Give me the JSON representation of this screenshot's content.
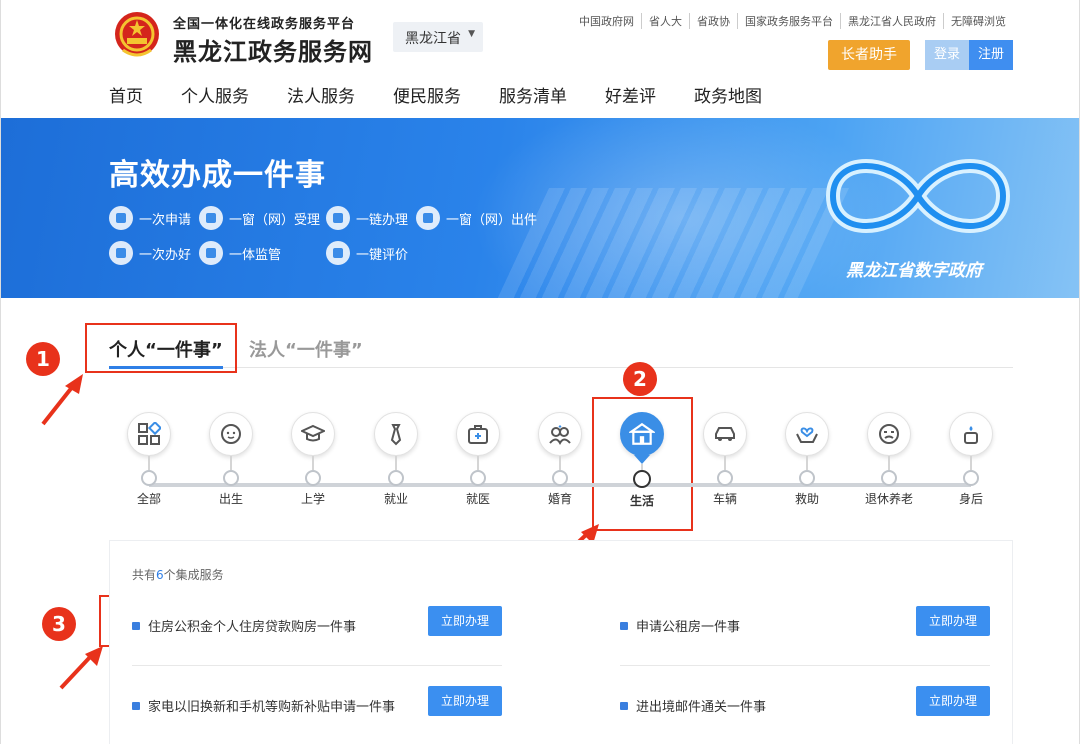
{
  "header": {
    "site_subtitle": "全国一体化在线政务服务平台",
    "site_title": "黑龙江政务服务网",
    "region": "黑龙江省",
    "top_links": [
      "中国政府网",
      "省人大",
      "省政协",
      "国家政务服务平台",
      "黑龙江省人民政府",
      "无障碍浏览"
    ],
    "elder_button": "长者助手",
    "login": "登录",
    "register": "注册",
    "nav": [
      "首页",
      "个人服务",
      "法人服务",
      "便民服务",
      "服务清单",
      "好差评",
      "政务地图"
    ]
  },
  "banner": {
    "title": "高效办成一件事",
    "features": [
      "一次申请",
      "一窗（网）受理",
      "一链办理",
      "一窗（网）出件",
      "一次办好",
      "一体监管",
      "一键评价"
    ],
    "logo_text": "黑龙江省数字政府"
  },
  "tabs": {
    "active": "个人“一件事”",
    "inactive": "法人“一件事”"
  },
  "annotations": [
    "1",
    "2",
    "3"
  ],
  "categories": [
    {
      "label": "全部",
      "icon": "grid-icon"
    },
    {
      "label": "出生",
      "icon": "baby-icon"
    },
    {
      "label": "上学",
      "icon": "graduation-cap-icon"
    },
    {
      "label": "就业",
      "icon": "tie-icon"
    },
    {
      "label": "就医",
      "icon": "medical-kit-icon"
    },
    {
      "label": "婚育",
      "icon": "couple-icon"
    },
    {
      "label": "生活",
      "icon": "house-icon"
    },
    {
      "label": "车辆",
      "icon": "car-icon"
    },
    {
      "label": "救助",
      "icon": "helping-hands-icon"
    },
    {
      "label": "退休养老",
      "icon": "elder-icon"
    },
    {
      "label": "身后",
      "icon": "candle-icon"
    }
  ],
  "active_category": "生活",
  "services": {
    "count_prefix": "共有",
    "count": "6",
    "count_suffix": "个集成服务",
    "items": [
      {
        "name": "住房公积金个人住房贷款购房一件事",
        "action": "立即办理"
      },
      {
        "name": "申请公租房一件事",
        "action": "立即办理"
      },
      {
        "name": "家电以旧换新和手机等购新补贴申请一件事",
        "action": "立即办理"
      },
      {
        "name": "进出境邮件通关一件事",
        "action": "立即办理"
      }
    ]
  },
  "colors": {
    "primary": "#3b8ff0",
    "accent": "#f0a42d",
    "annotation": "#e8321b"
  }
}
